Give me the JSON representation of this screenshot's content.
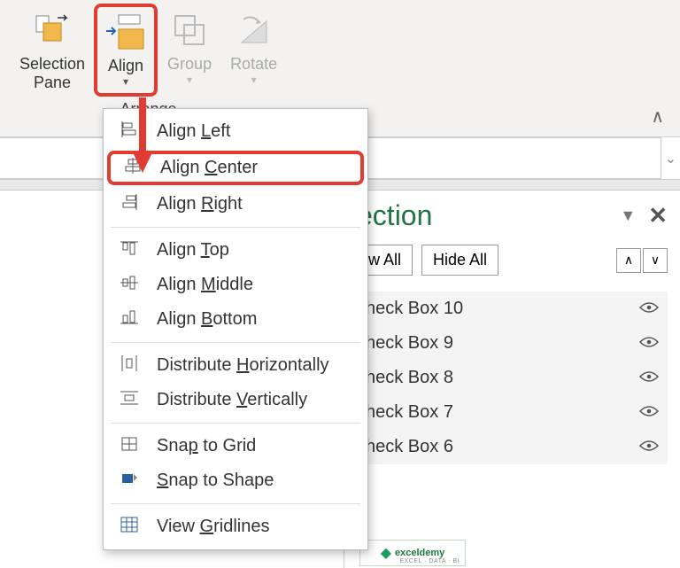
{
  "ribbon": {
    "selection_pane": "Selection\nPane",
    "align": "Align",
    "group": "Group",
    "rotate": "Rotate",
    "group_label": "Arrange"
  },
  "align_menu": {
    "items": [
      {
        "label_pre": "Align ",
        "u": "L",
        "label_post": "eft"
      },
      {
        "label_pre": "Align ",
        "u": "C",
        "label_post": "enter"
      },
      {
        "label_pre": "Align ",
        "u": "R",
        "label_post": "ight"
      },
      {
        "label_pre": "Align ",
        "u": "T",
        "label_post": "op"
      },
      {
        "label_pre": "Align ",
        "u": "M",
        "label_post": "iddle"
      },
      {
        "label_pre": "Align ",
        "u": "B",
        "label_post": "ottom"
      },
      {
        "label_pre": "Distribute ",
        "u": "H",
        "label_post": "orizontally"
      },
      {
        "label_pre": "Distribute ",
        "u": "V",
        "label_post": "ertically"
      },
      {
        "label_pre": "Sna",
        "u": "p",
        "label_post": " to Grid"
      },
      {
        "label_pre": "",
        "u": "S",
        "label_post": "nap to Shape"
      },
      {
        "label_pre": "View ",
        "u": "G",
        "label_post": "ridlines"
      }
    ]
  },
  "selection": {
    "title": "ection",
    "show_all": "w All",
    "hide_all": "Hide All",
    "items": [
      {
        "label": "heck Box 10"
      },
      {
        "label": "heck Box 9"
      },
      {
        "label": "heck Box 8"
      },
      {
        "label": "heck Box 7"
      },
      {
        "label": "heck Box 6"
      }
    ]
  },
  "watermark": {
    "brand": "exceldemy",
    "sub": "EXCEL · DATA · BI"
  }
}
